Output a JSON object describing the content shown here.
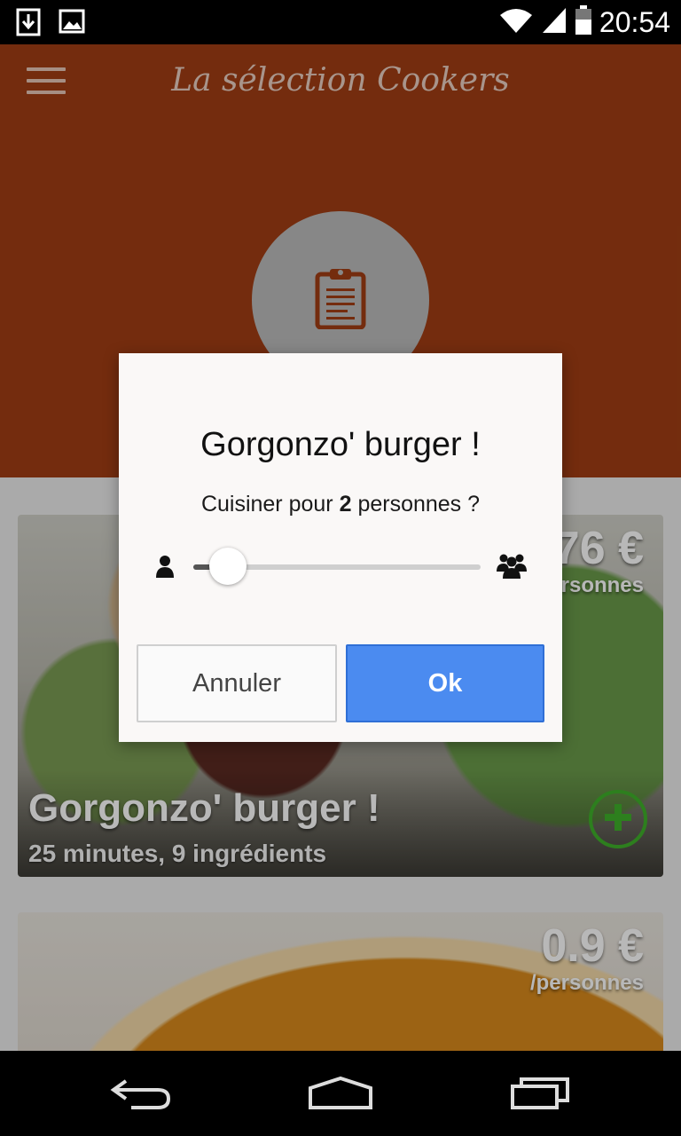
{
  "status_bar": {
    "time": "20:54",
    "icons": [
      "download-icon",
      "image-icon",
      "wifi-icon",
      "signal-icon",
      "battery-icon"
    ]
  },
  "app_bar": {
    "title": "La sélection Cookers"
  },
  "colors": {
    "brand": "#a13e14",
    "ok_button": "#4b8bf0",
    "add_green": "#3fb12a"
  },
  "recipes": [
    {
      "name": "Gorgonzo' burger !",
      "meta": "25 minutes, 9 ingrédients",
      "price": "3.76 €",
      "price_unit": "/personnes"
    },
    {
      "name": "",
      "meta": "",
      "price": "0.9 €",
      "price_unit": "/personnes"
    }
  ],
  "dialog": {
    "title": "Gorgonzo' burger !",
    "question_prefix": "Cuisiner pour",
    "count": "2",
    "question_suffix": "personnes ?",
    "slider_fraction": 0.12,
    "cancel_label": "Annuler",
    "ok_label": "Ok"
  }
}
